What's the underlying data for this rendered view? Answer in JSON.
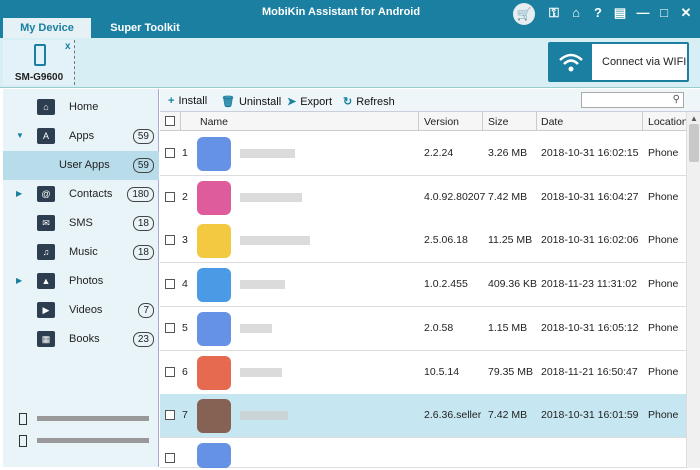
{
  "header": {
    "tabs": [
      {
        "label": "My Device"
      },
      {
        "label": "Super Toolkit"
      }
    ],
    "title": "MobiKin Assistant for Android"
  },
  "device": {
    "name": "SM-G9600",
    "close_label": "x"
  },
  "wifi": {
    "label": "Connect via WIFI"
  },
  "sidebar": {
    "items": [
      {
        "label": "Home",
        "count": null
      },
      {
        "label": "Apps",
        "count": "59"
      },
      {
        "label": "User Apps",
        "count": "59"
      },
      {
        "label": "Contacts",
        "count": "180"
      },
      {
        "label": "SMS",
        "count": "18"
      },
      {
        "label": "Music",
        "count": "18"
      },
      {
        "label": "Photos",
        "count": null
      },
      {
        "label": "Videos",
        "count": "7"
      },
      {
        "label": "Books",
        "count": "23"
      }
    ]
  },
  "toolbar": {
    "install": "Install",
    "uninstall": "Uninstall",
    "export": "Export",
    "refresh": "Refresh"
  },
  "search": {
    "placeholder": ""
  },
  "table": {
    "columns": [
      "Name",
      "Version",
      "Size",
      "Date",
      "Location"
    ],
    "rows": [
      {
        "num": "1",
        "version": "2.2.24",
        "size": "3.26 MB",
        "date": "2018-10-31 16:02:15",
        "location": "Phone",
        "icon_color": "#4a7fe0"
      },
      {
        "num": "2",
        "version": "4.0.92.80207",
        "size": "7.42 MB",
        "date": "2018-10-31 16:04:27",
        "location": "Phone",
        "icon_color": "#d8408a"
      },
      {
        "num": "3",
        "version": "2.5.06.18",
        "size": "11.25 MB",
        "date": "2018-10-31 16:02:06",
        "location": "Phone",
        "icon_color": "#f0c020"
      },
      {
        "num": "4",
        "version": "1.0.2.455",
        "size": "409.36 KB",
        "date": "2018-11-23 11:31:02",
        "location": "Phone",
        "icon_color": "#2c88e0"
      },
      {
        "num": "5",
        "version": "2.0.58",
        "size": "1.15 MB",
        "date": "2018-10-31 16:05:12",
        "location": "Phone",
        "icon_color": "#4a7fe0"
      },
      {
        "num": "6",
        "version": "10.5.14",
        "size": "79.35 MB",
        "date": "2018-11-21 16:50:47",
        "location": "Phone",
        "icon_color": "#e05030"
      },
      {
        "num": "7",
        "version": "2.6.36.seller",
        "size": "7.42 MB",
        "date": "2018-10-31 16:01:59",
        "location": "Phone",
        "icon_color": "#7a4a3a"
      }
    ]
  },
  "colors": {
    "accent": "#1a7fa0",
    "selected_row": "#c6e6f1"
  }
}
